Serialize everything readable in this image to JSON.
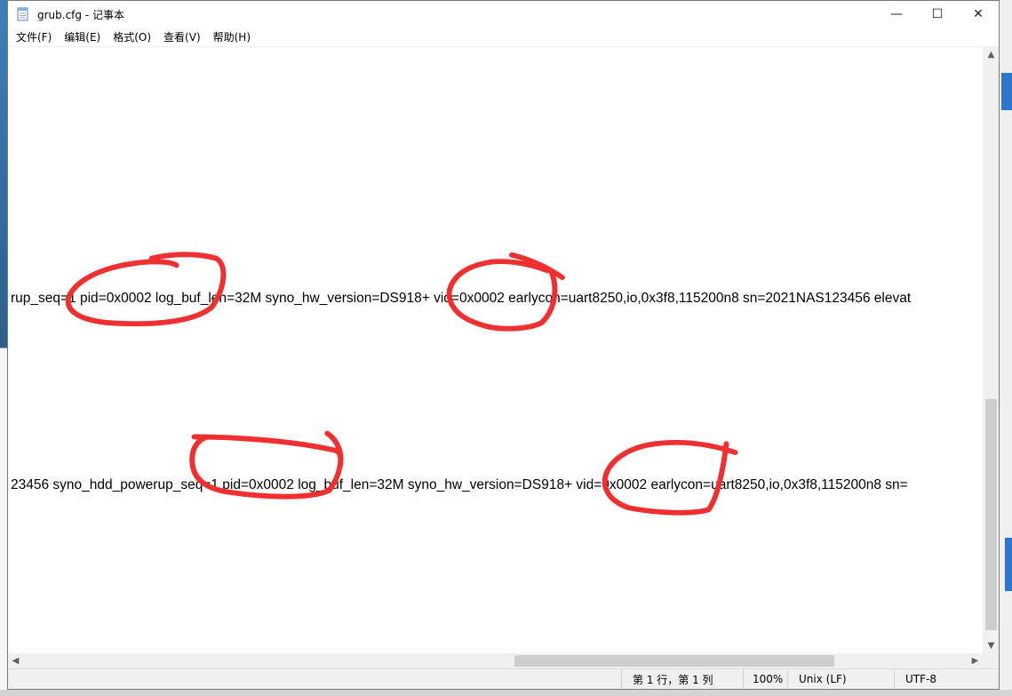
{
  "window": {
    "title": "grub.cfg - 记事本",
    "controls": {
      "minimize": "—",
      "maximize": "☐",
      "close": "✕"
    }
  },
  "menu": {
    "items": [
      {
        "label": "文件(F)"
      },
      {
        "label": "编辑(E)"
      },
      {
        "label": "格式(O)"
      },
      {
        "label": "查看(V)"
      },
      {
        "label": "帮助(H)"
      }
    ]
  },
  "editor": {
    "lines": [
      "rup_seq=1 pid=0x0002 log_buf_len=32M syno_hw_version=DS918+ vid=0x0002 earlycon=uart8250,io,0x3f8,115200n8 sn=2021NAS123456 elevat",
      "23456 syno_hdd_powerup_seq=1 pid=0x0002 log_buf_len=32M syno_hw_version=DS918+ vid=0x0002 earlycon=uart8250,io,0x3f8,115200n8 sn="
    ],
    "annotation_color": "#f03030"
  },
  "statusbar": {
    "position": "第 1 行，第 1 列",
    "zoom": "100%",
    "line_ending": "Unix (LF)",
    "encoding": "UTF-8"
  },
  "scrollbars": {
    "up_arrow": "▲",
    "down_arrow": "▼",
    "left_arrow": "◀",
    "right_arrow": "▶"
  }
}
